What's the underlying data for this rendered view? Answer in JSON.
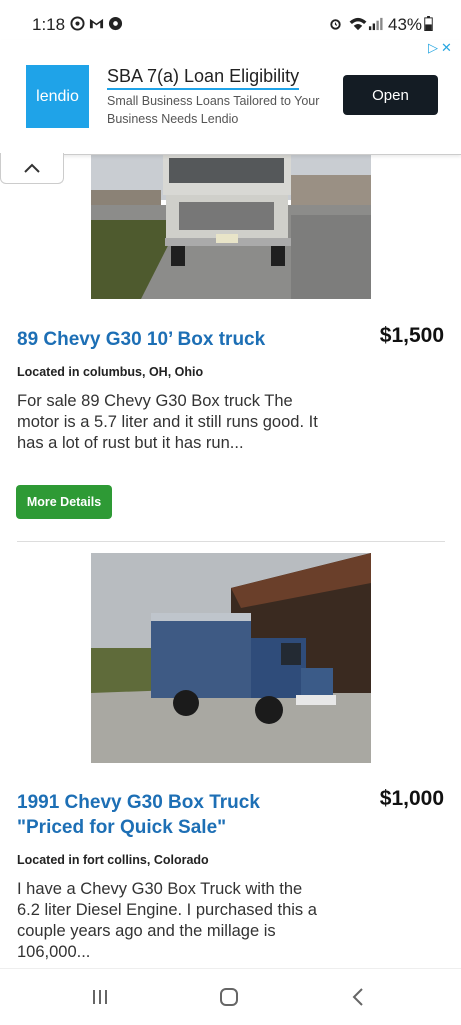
{
  "status_bar": {
    "time": "1:18",
    "battery": "43%"
  },
  "ad": {
    "logo_text": "lendio",
    "title": "SBA 7(a) Loan Eligibility",
    "description": "Small Business Loans Tailored to Your Business Needs Lendio",
    "open_label": "Open",
    "adchoices_icon": "adchoices-icon",
    "close_icon": "close-icon"
  },
  "listings": [
    {
      "title": "89 Chevy G30 10’ Box truck",
      "price": "$1,500",
      "location": "Located in columbus, OH, Ohio",
      "description": "For sale 89 Chevy G30 Box truck The motor is a 5.7 liter and it still runs good. It has a lot of rust but it has run...",
      "details_label": "More Details"
    },
    {
      "title": "1991 Chevy G30 Box Truck \"Priced for Quick Sale\"",
      "price": "$1,000",
      "location": "Located in fort collins, Colorado",
      "description": "I have a Chevy G30 Box Truck with the 6.2 liter Diesel Engine. I purchased this a couple years ago and the millage is 106,000..."
    }
  ],
  "nav_bar": {
    "icons": [
      "recents-icon",
      "home-icon",
      "back-icon"
    ]
  },
  "colors": {
    "link": "#1d6fb5",
    "button_green": "#2e9a35",
    "ad_blue": "#1fa3e8",
    "open_button": "#141c24"
  }
}
